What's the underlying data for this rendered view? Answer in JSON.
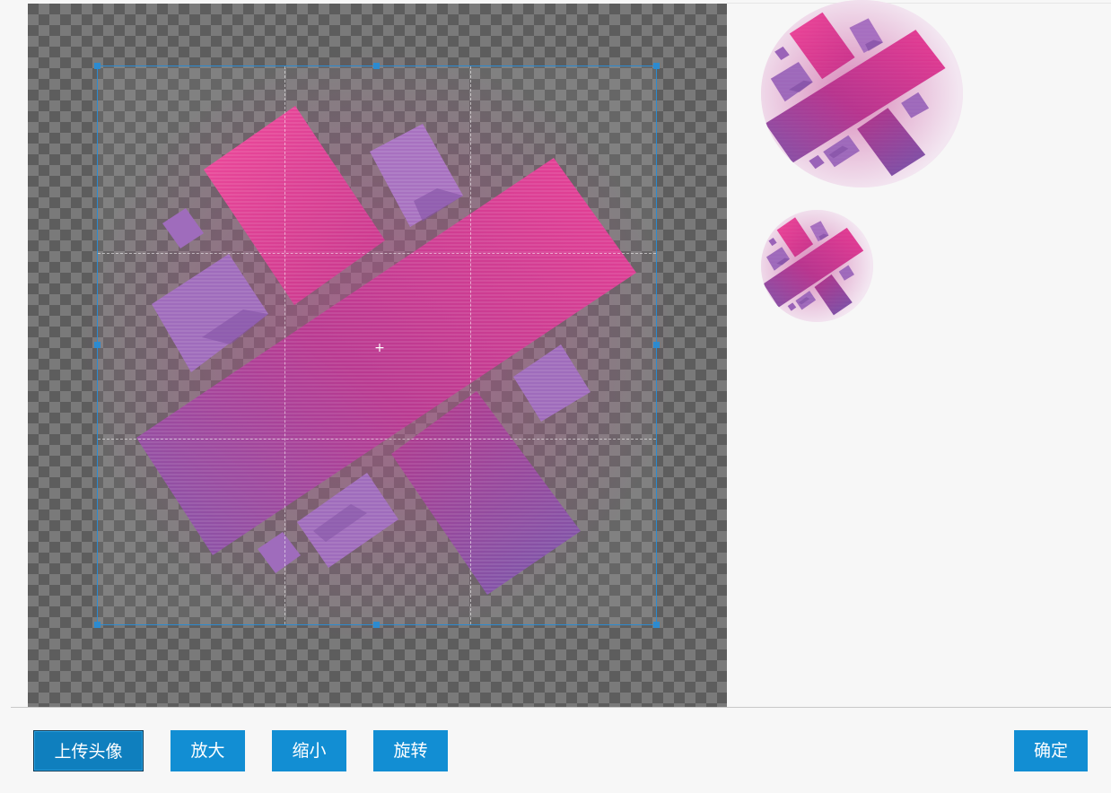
{
  "toolbar": {
    "upload_label": "上传头像",
    "zoom_in_label": "放大",
    "zoom_out_label": "缩小",
    "rotate_label": "旋转",
    "confirm_label": "确定"
  },
  "editor": {
    "center_mark": "+"
  },
  "colors": {
    "accent": "#128ed3",
    "crop_border": "#2c8bd0",
    "pink": "#e8358f",
    "purple": "#8a5bb0"
  }
}
